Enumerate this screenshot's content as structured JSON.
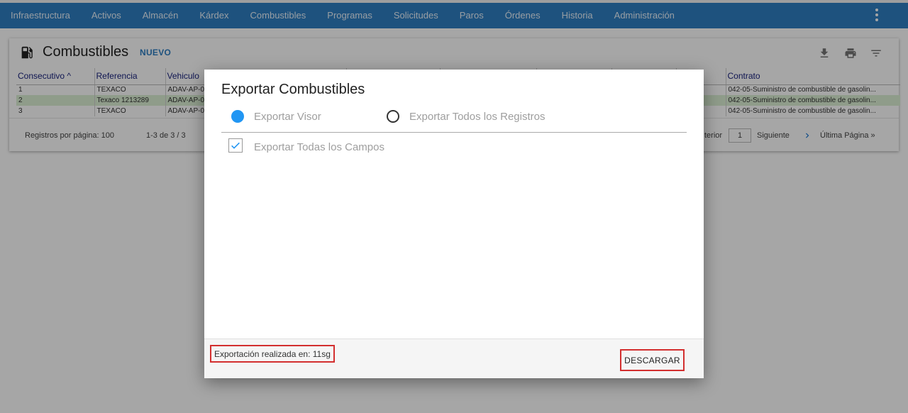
{
  "nav": {
    "items": [
      "Infraestructura",
      "Activos",
      "Almacén",
      "Kárdex",
      "Combustibles",
      "Programas",
      "Solicitudes",
      "Paros",
      "Órdenes",
      "Historia",
      "Administración"
    ],
    "menu_icon": "more-vert-icon"
  },
  "page": {
    "title": "Combustibles",
    "new_label": "NUEVO",
    "icons": [
      "gas-station-icon",
      "download-icon",
      "print-icon",
      "filter-icon"
    ]
  },
  "table": {
    "columns": [
      "Consecutivo ^",
      "Referencia",
      "Vehiculo",
      "",
      "",
      "",
      "",
      "",
      "Contrato"
    ],
    "rows": [
      [
        "1",
        "TEXACO",
        "ADAV-AP-0",
        "",
        "",
        "",
        "",
        "",
        "042-05-Suministro de combustible de gasolin..."
      ],
      [
        "2",
        "Texaco 1213289",
        "ADAV-AP-0",
        "",
        "",
        "",
        "",
        "",
        "042-05-Suministro de combustible de gasolin..."
      ],
      [
        "3",
        "TEXACO",
        "ADAV-AP-0",
        "",
        "",
        "",
        "",
        "",
        "042-05-Suministro de combustible de gasolin..."
      ]
    ],
    "selected_row": 1
  },
  "pagination": {
    "per_page_label": "Registros por página: 100",
    "range": "1-3 de 3 / 3",
    "prev_label": "terior",
    "page": "1",
    "next_label": "Siguiente",
    "last_label": "Última Página »"
  },
  "dialog": {
    "title": "Exportar Combustibles",
    "option_viewer": "Exportar Visor",
    "option_all": "Exportar Todos los Registros",
    "all_fields": "Exportar Todas los Campos",
    "status": "Exportación realizada en: 11sg",
    "download": "DESCARGAR"
  },
  "colors": {
    "navbar": "#2f7fc2",
    "accent": "#2196f3",
    "highlight": "#d32f2f",
    "selected_row": "#dcf0d5"
  }
}
